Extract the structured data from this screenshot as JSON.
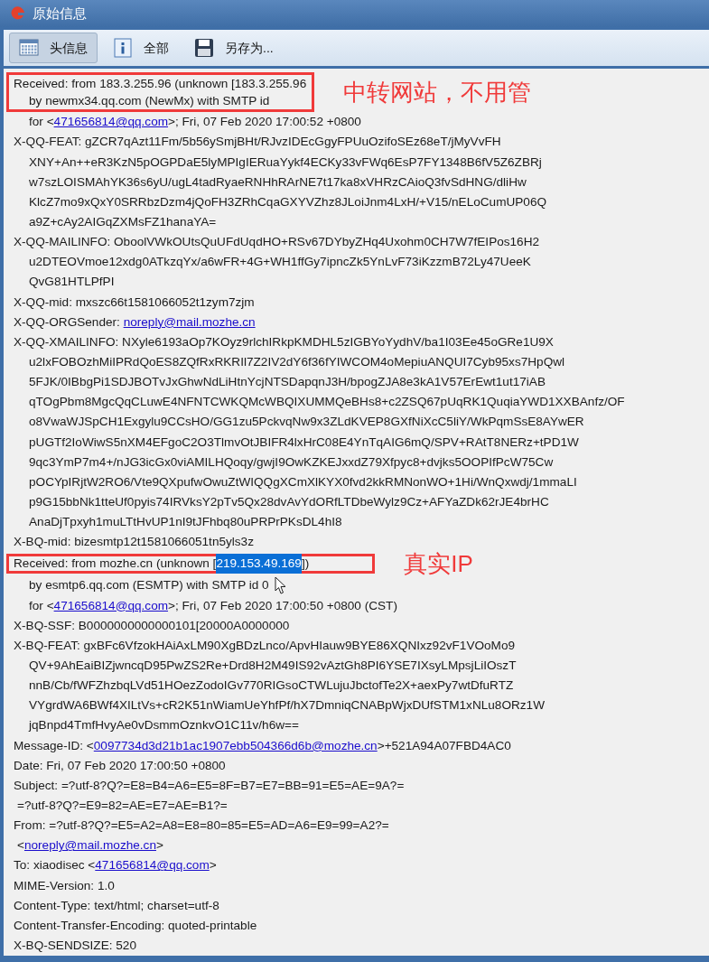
{
  "window": {
    "title": "原始信息"
  },
  "toolbar": [
    {
      "label": "头信息",
      "selected": true
    },
    {
      "label": "全部",
      "selected": false
    },
    {
      "label": "另存为...",
      "selected": false
    }
  ],
  "entries": [
    {
      "kind": "boxed",
      "note": "中转网站，不用管",
      "lines": [
        {
          "kind": "field",
          "segments": [
            {
              "kind": "text",
              "text": "Received: from 183.3.255.96 (unknown [183.3.255.96"
            }
          ]
        },
        {
          "kind": "continuation",
          "segments": [
            {
              "kind": "text",
              "text": "by newmx34.qq.com (NewMx) with SMTP id"
            }
          ]
        }
      ]
    },
    {
      "kind": "continuation",
      "segments": [
        {
          "kind": "text",
          "text": "for <"
        },
        {
          "kind": "link",
          "text": "471656814@qq.com"
        },
        {
          "kind": "text",
          "text": ">; Fri, 07 Feb 2020 17:00:52 +0800"
        }
      ]
    },
    {
      "kind": "field",
      "segments": [
        {
          "kind": "text",
          "text": "X-QQ-FEAT: gZCR7qAzt11Fm/5b56ySmjBHt/RJvzIDEcGgyFPUuOzifoSEz68eT/jMyVvFH"
        }
      ]
    },
    {
      "kind": "continuation",
      "segments": [
        {
          "kind": "text",
          "text": "XNY+An++eR3KzN5pOGPDaE5lyMPIgIERuaYykf4ECKy33vFWq6EsP7FY1348B6fV5Z6ZBRj"
        }
      ]
    },
    {
      "kind": "continuation",
      "segments": [
        {
          "kind": "text",
          "text": "w7szLOISMAhYK36s6yU/ugL4tadRyaeRNHhRArNE7t17ka8xVHRzCAioQ3fvSdHNG/dliHw"
        }
      ]
    },
    {
      "kind": "continuation",
      "segments": [
        {
          "kind": "text",
          "text": "KlcZ7mo9xQxY0SRRbzDzm4jQoFH3ZRhCqaGXYVZhz8JLoiJnm4LxH/+V15/nELoCumUP06Q"
        }
      ]
    },
    {
      "kind": "continuation",
      "segments": [
        {
          "kind": "text",
          "text": "a9Z+cAy2AIGqZXMsFZ1hanaYA="
        }
      ]
    },
    {
      "kind": "field",
      "segments": [
        {
          "kind": "text",
          "text": "X-QQ-MAILINFO: OboolVWkOUtsQuUFdUqdHO+RSv67DYbyZHq4Uxohm0CH7W7fEIPos16H2"
        }
      ]
    },
    {
      "kind": "continuation",
      "segments": [
        {
          "kind": "text",
          "text": "u2DTEOVmoe12xdg0ATkzqYx/a6wFR+4G+WH1ffGy7ipncZk5YnLvF73iKzzmB72Ly47UeeK"
        }
      ]
    },
    {
      "kind": "continuation",
      "segments": [
        {
          "kind": "text",
          "text": "QvG81HTLPfPI"
        }
      ]
    },
    {
      "kind": "field",
      "segments": [
        {
          "kind": "text",
          "text": "X-QQ-mid: mxszc66t1581066052t1zym7zjm"
        }
      ]
    },
    {
      "kind": "field",
      "segments": [
        {
          "kind": "text",
          "text": "X-QQ-ORGSender: "
        },
        {
          "kind": "link",
          "text": "noreply@mail.mozhe.cn"
        }
      ]
    },
    {
      "kind": "field",
      "segments": [
        {
          "kind": "text",
          "text": "X-QQ-XMAILINFO: NXyle6193aOp7KOyz9rlchIRkpKMDHL5zIGBYoYydhV/ba1I03Ee45oGRe1U9X"
        }
      ]
    },
    {
      "kind": "continuation",
      "segments": [
        {
          "kind": "text",
          "text": "u2lxFOBOzhMiIPRdQoES8ZQfRxRKRIl7Z2IV2dY6f36fYIWCOM4oMepiuANQUI7Cyb95xs7HpQwl"
        }
      ]
    },
    {
      "kind": "continuation",
      "segments": [
        {
          "kind": "text",
          "text": "5FJK/0IBbgPi1SDJBOTvJxGhwNdLiHtnYcjNTSDapqnJ3H/bpogZJA8e3kA1V57ErEwt1ut17iAB"
        }
      ]
    },
    {
      "kind": "continuation",
      "segments": [
        {
          "kind": "text",
          "text": "qTOgPbm8MgcQqCLuwE4NFNTCWKQMcWBQIXUMMQeBHs8+c2ZSQ67pUqRK1QuqiaYWD1XXBAnfz/OF"
        }
      ]
    },
    {
      "kind": "continuation",
      "segments": [
        {
          "kind": "text",
          "text": "o8VwaWJSpCH1Exgylu9CCsHO/GG1zu5PckvqNw9x3ZLdKVEP8GXfNiXcC5liY/WkPqmSsE8AYwER"
        }
      ]
    },
    {
      "kind": "continuation",
      "segments": [
        {
          "kind": "text",
          "text": "pUGTf2IoWiwS5nXM4EFgoC2O3TlmvOtJBIFR4lxHrC08E4YnTqAIG6mQ/SPV+RAtT8NERz+tPD1W"
        }
      ]
    },
    {
      "kind": "continuation",
      "segments": [
        {
          "kind": "text",
          "text": "9qc3YmP7m4+/nJG3icGx0viAMILHQoqy/gwjI9OwKZKEJxxdZ79Xfpyc8+dvjks5OOPIfPcW75Cw"
        }
      ]
    },
    {
      "kind": "continuation",
      "segments": [
        {
          "kind": "text",
          "text": "pOCYpIRjtW2RO6/Vte9QXpufwOwuZtWIQQgXCmXlKYX0fvd2kkRMNonWO+1Hi/WnQxwdj/1mmaLI"
        }
      ]
    },
    {
      "kind": "continuation",
      "segments": [
        {
          "kind": "text",
          "text": "p9G15bbNk1tteUf0pyis74IRVksY2pTv5Qx28dvAvYdORfLTDbeWylz9Cz+AFYaZDk62rJE4brHC"
        }
      ]
    },
    {
      "kind": "continuation",
      "segments": [
        {
          "kind": "text",
          "text": "AnaDjTpxyh1muLTtHvUP1nI9tJFhbq80uPRPrPKsDL4hI8"
        }
      ]
    },
    {
      "kind": "field",
      "segments": [
        {
          "kind": "text",
          "text": "X-BQ-mid: bizesmtp12t1581066051tn5yls3z"
        }
      ]
    },
    {
      "kind": "boxed",
      "note": "真实IP",
      "lines": [
        {
          "kind": "field",
          "segments": [
            {
              "kind": "text",
              "text": "Received: from mozhe.cn (unknown ["
            },
            {
              "kind": "selected",
              "text": "219.153.49.169"
            },
            {
              "kind": "text",
              "text": "])"
            }
          ]
        }
      ]
    },
    {
      "kind": "continuation",
      "cursor": true,
      "segments": [
        {
          "kind": "text",
          "text": "by esmtp6.qq.com (ESMTP) with SMTP id 0"
        }
      ]
    },
    {
      "kind": "continuation",
      "segments": [
        {
          "kind": "text",
          "text": "for <"
        },
        {
          "kind": "link",
          "text": "471656814@qq.com"
        },
        {
          "kind": "text",
          "text": ">; Fri, 07 Feb 2020 17:00:50 +0800 (CST)"
        }
      ]
    },
    {
      "kind": "field",
      "segments": [
        {
          "kind": "text",
          "text": "X-BQ-SSF: B0000000000000101[20000A0000000"
        }
      ]
    },
    {
      "kind": "field",
      "segments": [
        {
          "kind": "text",
          "text": "X-BQ-FEAT: gxBFc6VfzokHAiAxLM90XgBDzLnco/ApvHIauw9BYE86XQNIxz92vF1VOoMo9"
        }
      ]
    },
    {
      "kind": "continuation",
      "segments": [
        {
          "kind": "text",
          "text": "QV+9AhEaiBIZjwncqD95PwZS2Re+Drd8H2M49IS92vAztGh8PI6YSE7IXsyLMpsjLiIOszT"
        }
      ]
    },
    {
      "kind": "continuation",
      "segments": [
        {
          "kind": "text",
          "text": "nnB/Cb/fWFZhzbqLVd51HOezZodoIGv770RIGsoCTWLujuJbctofTe2X+aexPy7wtDfuRTZ"
        }
      ]
    },
    {
      "kind": "continuation",
      "segments": [
        {
          "kind": "text",
          "text": "VYgrdWA6BWf4XILtVs+cR2K51nWiamUeYhfPf/hX7DmniqCNABpWjxDUfSTM1xNLu8ORz1W"
        }
      ]
    },
    {
      "kind": "continuation",
      "segments": [
        {
          "kind": "text",
          "text": "jqBnpd4TmfHvyAe0vDsmmOznkvO1C11v/h6w=="
        }
      ]
    },
    {
      "kind": "field",
      "segments": [
        {
          "kind": "text",
          "text": "Message-ID: <"
        },
        {
          "kind": "link",
          "text": "0097734d3d21b1ac1907ebb504366d6b@mozhe.cn"
        },
        {
          "kind": "text",
          "text": ">+521A94A07FBD4AC0"
        }
      ]
    },
    {
      "kind": "field",
      "segments": [
        {
          "kind": "text",
          "text": "Date: Fri, 07 Feb 2020 17:00:50 +0800"
        }
      ]
    },
    {
      "kind": "field",
      "segments": [
        {
          "kind": "text",
          "text": "Subject: =?utf-8?Q?=E8=B4=A6=E5=8F=B7=E7=BB=91=E5=AE=9A?="
        }
      ]
    },
    {
      "kind": "folded",
      "segments": [
        {
          "kind": "text",
          "text": "=?utf-8?Q?=E9=82=AE=E7=AE=B1?="
        }
      ]
    },
    {
      "kind": "field",
      "segments": [
        {
          "kind": "text",
          "text": "From: =?utf-8?Q?=E5=A2=A8=E8=80=85=E5=AD=A6=E9=99=A2?="
        }
      ]
    },
    {
      "kind": "folded",
      "segments": [
        {
          "kind": "text",
          "text": "<"
        },
        {
          "kind": "link",
          "text": "noreply@mail.mozhe.cn"
        },
        {
          "kind": "text",
          "text": ">"
        }
      ]
    },
    {
      "kind": "field",
      "segments": [
        {
          "kind": "text",
          "text": "To: xiaodisec <"
        },
        {
          "kind": "link",
          "text": "471656814@qq.com"
        },
        {
          "kind": "text",
          "text": ">"
        }
      ]
    },
    {
      "kind": "field",
      "segments": [
        {
          "kind": "text",
          "text": "MIME-Version: 1.0"
        }
      ]
    },
    {
      "kind": "field",
      "segments": [
        {
          "kind": "text",
          "text": "Content-Type: text/html; charset=utf-8"
        }
      ]
    },
    {
      "kind": "field",
      "segments": [
        {
          "kind": "text",
          "text": "Content-Transfer-Encoding: quoted-printable"
        }
      ]
    },
    {
      "kind": "field",
      "segments": [
        {
          "kind": "text",
          "text": "X-BQ-SENDSIZE: 520"
        }
      ]
    }
  ]
}
